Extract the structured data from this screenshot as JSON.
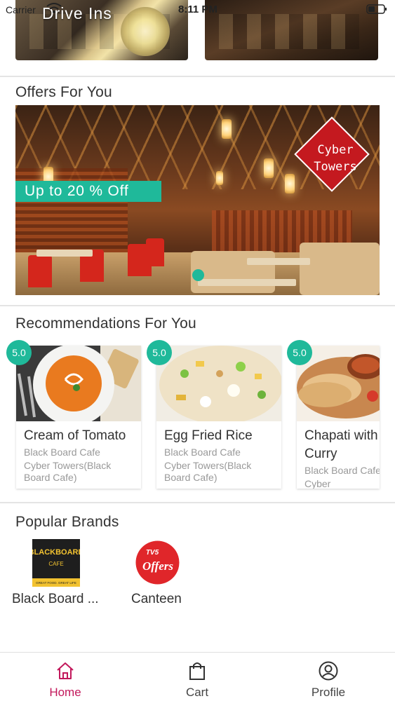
{
  "status_bar": {
    "carrier": "Carrier",
    "time": "8:11 PM"
  },
  "top_cards": {
    "first_title": "Drive Ins"
  },
  "offers": {
    "section_title": "Offers For You",
    "banner_tag": "Up to 20 % Off",
    "brand_badge_line1": "Cyber",
    "brand_badge_line2": "Towers"
  },
  "recommendations": {
    "section_title": "Recommendations For You",
    "items": [
      {
        "rating": "5.0",
        "name": "Cream of Tomato",
        "vendor": "Black Board Cafe",
        "location": "Cyber Towers(Black Board Cafe)"
      },
      {
        "rating": "5.0",
        "name": "Egg Fried Rice",
        "vendor": "Black Board Cafe",
        "location": "Cyber Towers(Black Board Cafe)"
      },
      {
        "rating": "5.0",
        "name": "Chapati with Curry",
        "vendor": "Black Board Cafe",
        "location": "Cyber Towers(Black Board Cafe)"
      }
    ]
  },
  "brands": {
    "section_title": "Popular Brands",
    "items": [
      {
        "label": "Black Board ...",
        "logo_line1": "BLACKBOARD",
        "logo_line2": "CAFE",
        "logo_line3": "GREAT FOOD. GREAT LIFE"
      },
      {
        "label": "Canteen",
        "logo_line1": "TV5",
        "logo_line2": "Offers"
      }
    ]
  },
  "bottom_nav": {
    "items": [
      {
        "label": "Home",
        "icon": "home-icon",
        "active": true
      },
      {
        "label": "Cart",
        "icon": "shopping-bag-icon",
        "active": false
      },
      {
        "label": "Profile",
        "icon": "user-icon",
        "active": false
      }
    ]
  },
  "colors": {
    "accent_teal": "#1fb99a",
    "active_nav": "#c2185b",
    "brand_red": "#c4191f"
  }
}
